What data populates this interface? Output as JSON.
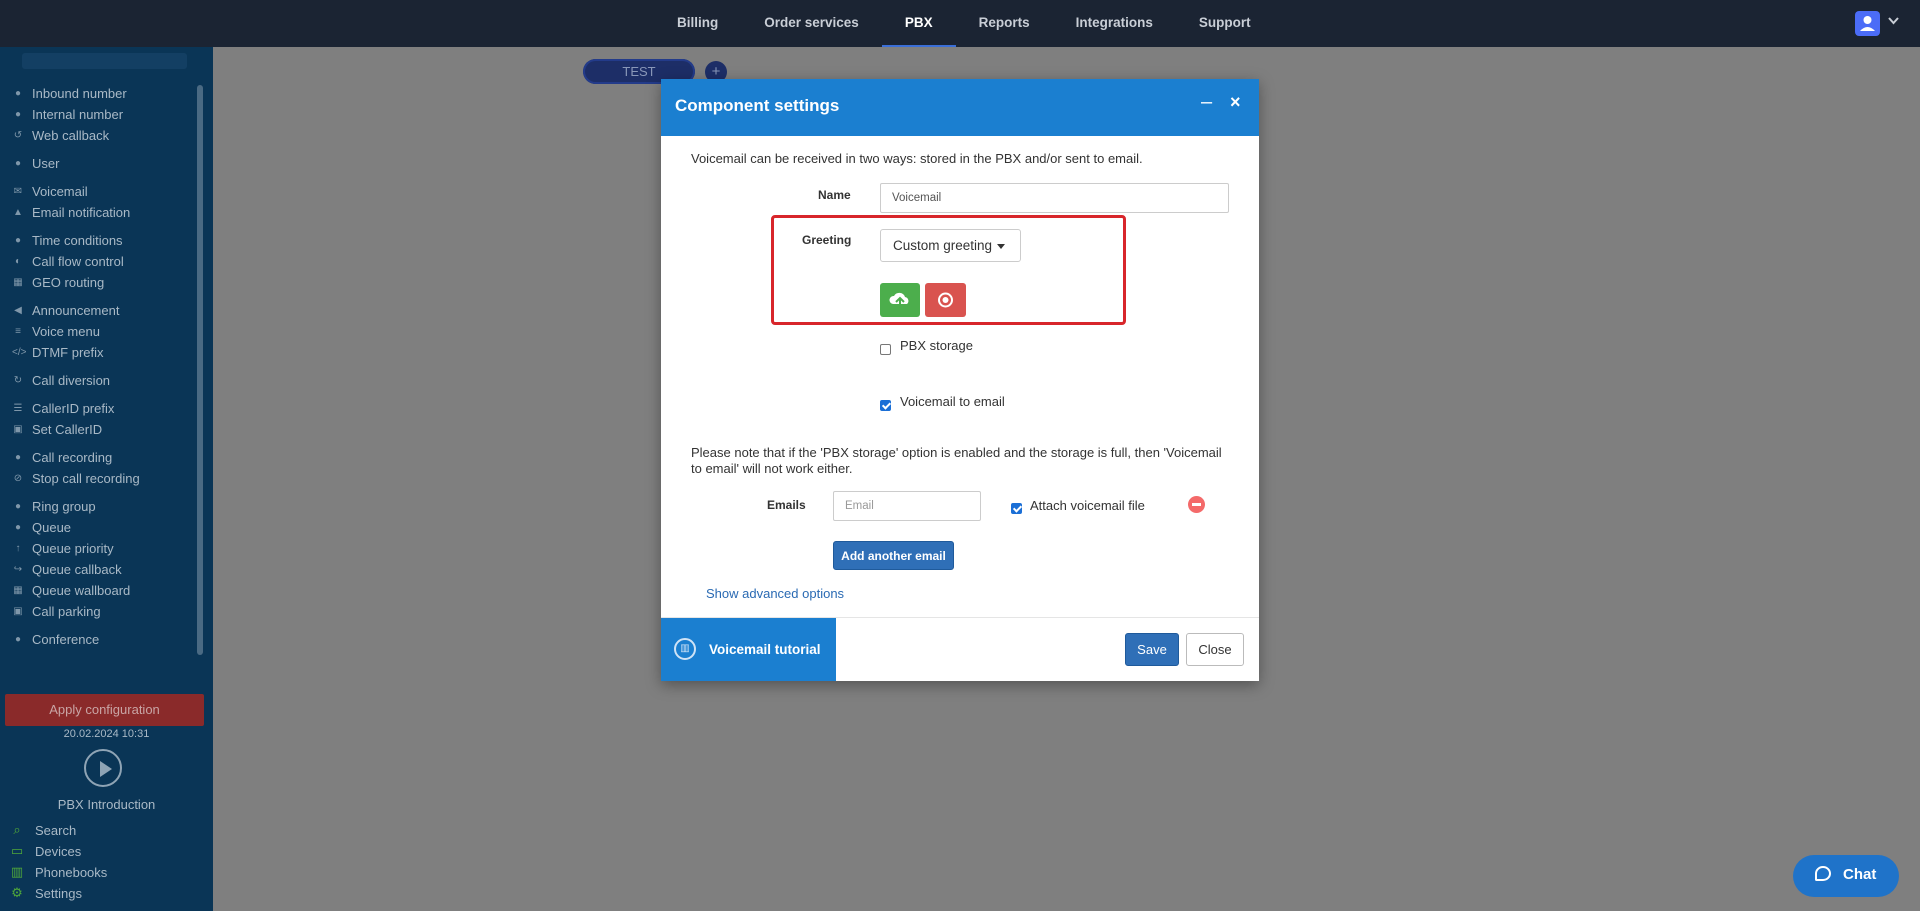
{
  "topnav": {
    "items": [
      "Billing",
      "Order services",
      "PBX",
      "Reports",
      "Integrations",
      "Support"
    ],
    "active": "PBX"
  },
  "sidebar": {
    "items": [
      {
        "label": "Inbound number",
        "icon": "phone-in-icon"
      },
      {
        "label": "Internal number",
        "icon": "map-pin-icon"
      },
      {
        "label": "Web callback",
        "icon": "undo-icon"
      },
      {
        "label": "User",
        "icon": "user-icon"
      },
      {
        "label": "Voicemail",
        "icon": "envelope-icon"
      },
      {
        "label": "Email notification",
        "icon": "bell-icon"
      },
      {
        "label": "Time conditions",
        "icon": "clock-icon"
      },
      {
        "label": "Call flow control",
        "icon": "toggle-icon"
      },
      {
        "label": "GEO routing",
        "icon": "sitemap-icon"
      },
      {
        "label": "Announcement",
        "icon": "bullhorn-icon"
      },
      {
        "label": "Voice menu",
        "icon": "menu-icon"
      },
      {
        "label": "DTMF prefix",
        "icon": "code-icon"
      },
      {
        "label": "Call diversion",
        "icon": "refresh-icon"
      },
      {
        "label": "CallerID prefix",
        "icon": "list-icon"
      },
      {
        "label": "Set CallerID",
        "icon": "id-card-icon"
      },
      {
        "label": "Call recording",
        "icon": "microphone-icon"
      },
      {
        "label": "Stop call recording",
        "icon": "microphone-off-icon"
      },
      {
        "label": "Ring group",
        "icon": "users-icon"
      },
      {
        "label": "Queue",
        "icon": "user-plus-icon"
      },
      {
        "label": "Queue priority",
        "icon": "arrow-up-icon"
      },
      {
        "label": "Queue callback",
        "icon": "share-icon"
      },
      {
        "label": "Queue wallboard",
        "icon": "table-icon"
      },
      {
        "label": "Call parking",
        "icon": "parking-icon"
      },
      {
        "label": "Conference",
        "icon": "comments-icon"
      }
    ],
    "apply_label": "Apply configuration",
    "date": "20.02.2024 10:31",
    "intro_label": "PBX Introduction",
    "tools": [
      {
        "label": "Search",
        "icon": "search-icon"
      },
      {
        "label": "Devices",
        "icon": "monitor-icon"
      },
      {
        "label": "Phonebooks",
        "icon": "book-icon"
      },
      {
        "label": "Settings",
        "icon": "gear-icon"
      }
    ]
  },
  "canvas": {
    "tab_label": "TEST",
    "add_tab": "+"
  },
  "modal": {
    "title": "Component settings",
    "intro": "Voicemail can be received in two ways: stored in the PBX and/or sent to email.",
    "name_label": "Name",
    "name_value": "Voicemail",
    "greeting_label": "Greeting",
    "greeting_value": "Custom greeting",
    "pbx_storage_label": "PBX storage",
    "pbx_storage_checked": false,
    "vm_to_email_label": "Voicemail to email",
    "vm_to_email_checked": true,
    "note": "Please note that if the 'PBX storage' option is enabled and the storage is full, then 'Voicemail to email' will not work either.",
    "emails_label": "Emails",
    "email_placeholder": "Email",
    "attach_label": "Attach voicemail file",
    "attach_checked": true,
    "add_email_label": "Add another email",
    "advanced_link": "Show advanced options",
    "tutorial_label": "Voicemail tutorial",
    "save_label": "Save",
    "close_label": "Close"
  },
  "chat": {
    "label": "Chat"
  },
  "colors": {
    "accent": "#1b7fd0",
    "nav_bg": "#1b2433",
    "sidebar_bg": "#0a3556",
    "highlight": "#d8262b"
  }
}
